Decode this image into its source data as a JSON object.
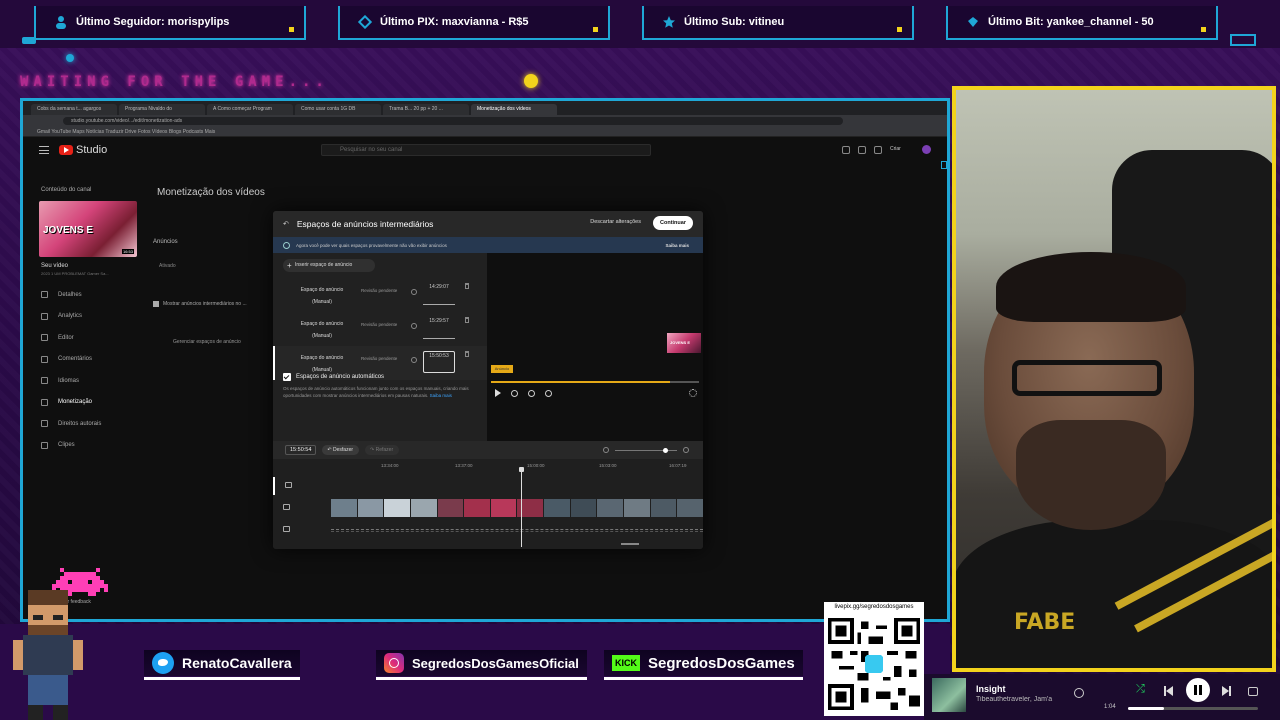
{
  "overlay": {
    "stats": [
      {
        "label": "Último Seguidor: morispylips",
        "icon": "user-icon"
      },
      {
        "label": "Último PIX: maxvianna - R$5",
        "icon": "pix-icon"
      },
      {
        "label": "Último Sub: vitineu",
        "icon": "star-icon"
      },
      {
        "label": "Último Bit: yankee_channel - 50",
        "icon": "bits-icon"
      }
    ],
    "waiting_text": "WAITING FOR THE GAME...",
    "accent_blue": "#1fa7d6",
    "accent_yellow": "#f3d31c",
    "accent_purple": "#2a0a48"
  },
  "browser": {
    "tabs": [
      "Cobs da semana t... agargos",
      "Programa Nivaldo do",
      "A Como começar Program",
      "Como usar conta 1G DB",
      "Trama B... 20 pp + 20 ...",
      "Monetização dos vídeos"
    ],
    "url": "studio.youtube.com/video/.../edit/monetization-ads",
    "bookmarks": "Gmail  YouTube  Maps  Notícias  Traduzir  Drive  Fotos  Vídeos  Blogs  Podcasts  Mais"
  },
  "studio": {
    "brand": "Studio",
    "search_placeholder": "Pesquisar no seu canal",
    "create_label": "Criar",
    "back_label": "Conteúdo do canal",
    "thumb_text": "JOVENS E",
    "thumb_duration": "16:53",
    "your_video": "Seu vídeo",
    "your_video_sub": "2023 1 UM PROBLEMAT Gamer Sa...",
    "nav": [
      "Detalhes",
      "Analytics",
      "Editor",
      "Comentários",
      "Idiomas",
      "Monetização",
      "Direitos autorais",
      "Clipes"
    ],
    "feedback": "Enviar feedback",
    "page_title": "Monetização dos vídeos",
    "ads_label": "Anúncios",
    "ads_sub": "Ativado",
    "midroll_check": "Mostrar anúncios intermediários no ...",
    "manage_link": "Gerenciar espaços de anúncio"
  },
  "modal": {
    "title": "Espaços de anúncios intermediários",
    "discard": "Descartar alterações",
    "continue": "Continuar",
    "info": "Agora você pode ver quais espaços provavelmente não vão exibir anúncios",
    "learn_more": "Saiba mais",
    "insert_btn": "Inserir espaço de anúncio",
    "slots": [
      {
        "name": "Espaço do anúncio (Manual)",
        "status": "Revisão pendente",
        "time": "14:29:07"
      },
      {
        "name": "Espaço do anúncio (Manual)",
        "status": "Revisão pendente",
        "time": "15:29:57"
      },
      {
        "name": "Espaço do anúncio (Manual)",
        "status": "Revisão pendente",
        "time": "15:50:53"
      }
    ],
    "auto_label": "Espaços de anúncio automáticos",
    "auto_desc": "Os espaços de anúncio automáticos funcionam junto com os espaços manuais, criando mais oportunidades com mostrar anúncios intermediários em pausas naturais.",
    "auto_link": "Saiba mais",
    "marker_label": "Anúncio",
    "current_time": "15:50:54",
    "undo": "Desfazer",
    "redo": "Refazer",
    "ruler": [
      "13:34:00",
      "13:37:00",
      "15:00:00",
      "15:03:00",
      "16:07:19"
    ],
    "preview_progress": 0.86,
    "zoom_level": 0.8
  },
  "social": {
    "twitter": "RenatoCavallera",
    "instagram": "SegredosDosGamesOficial",
    "kick_badge": "KICK",
    "kick": "SegredosDosGames",
    "qr_url": "livepix.gg/segredosdosgames"
  },
  "player": {
    "song": "Insight",
    "artist": "Tibeauthetraveler, Jam'a",
    "time": "1:04",
    "progress": 0.28
  }
}
